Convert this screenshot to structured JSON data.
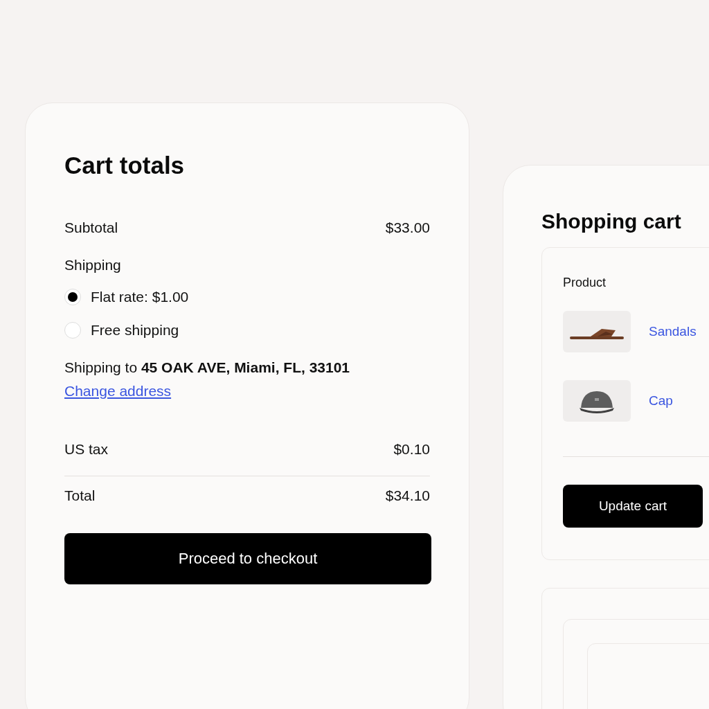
{
  "cart_totals": {
    "title": "Cart totals",
    "subtotal": {
      "label": "Subtotal",
      "value": "$33.00"
    },
    "shipping": {
      "label": "Shipping",
      "options": [
        {
          "label": "Flat rate: $1.00",
          "selected": true
        },
        {
          "label": "Free shipping",
          "selected": false
        }
      ],
      "destination": "Shipping to **45 OAK AVE, Miami, FL, 33101**",
      "change_link": "Change address"
    },
    "tax": {
      "label": "US tax",
      "value": "$0.10"
    },
    "total": {
      "label": "Total",
      "value": "$34.10"
    },
    "checkout_button": "Proceed to checkout"
  },
  "shopping_cart": {
    "title": "Shopping cart",
    "column": "Product",
    "items": [
      {
        "name": "Sandals",
        "kind": "sandal"
      },
      {
        "name": "Cap",
        "kind": "cap"
      }
    ],
    "update_button": "Update cart"
  }
}
